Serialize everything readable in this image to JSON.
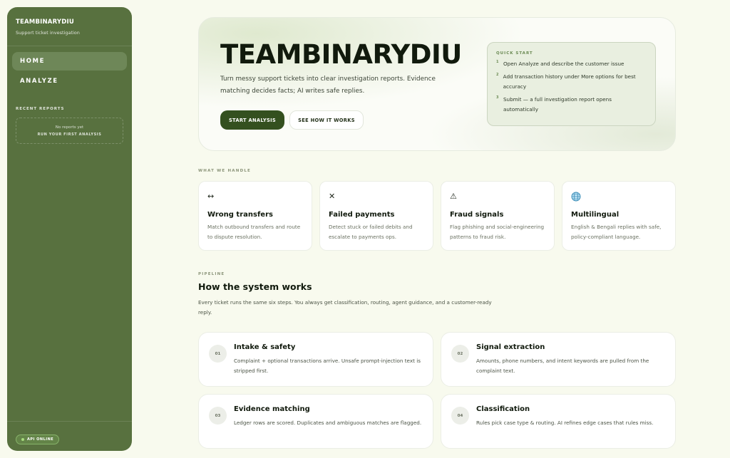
{
  "sidebar": {
    "title": "TEAMBINARYDIU",
    "subtitle": "Support ticket investigation",
    "nav": [
      {
        "label": "HOME",
        "active": true
      },
      {
        "label": "ANALYZE",
        "active": false
      }
    ],
    "recent_reports_title": "RECENT REPORTS",
    "empty_text": "No reports yet",
    "empty_cta": "RUN YOUR FIRST ANALYSIS",
    "api_status": "API ONLINE"
  },
  "hero": {
    "title": "TEAMBINARYDIU",
    "description": "Turn messy support tickets into clear investigation reports. Evidence matching decides facts; AI writes safe replies.",
    "primary_button": "START ANALYSIS",
    "secondary_button": "SEE HOW IT WORKS",
    "quick_start": {
      "title": "QUICK START",
      "items": [
        {
          "num": "1",
          "text": "Open Analyze and describe the customer issue"
        },
        {
          "num": "2",
          "text": "Add transaction history under More options for best accuracy"
        },
        {
          "num": "3",
          "text": "Submit — a full investigation report opens automatically"
        }
      ]
    }
  },
  "handle": {
    "label": "WHAT WE HANDLE",
    "cards": [
      {
        "icon": "arrows-horizontal-icon",
        "glyph": "↔",
        "title": "Wrong transfers",
        "desc": "Match outbound transfers and route to dispute resolution."
      },
      {
        "icon": "x-icon",
        "glyph": "✕",
        "title": "Failed payments",
        "desc": "Detect stuck or failed debits and escalate to payments ops."
      },
      {
        "icon": "warning-icon",
        "glyph": "⚠",
        "title": "Fraud signals",
        "desc": "Flag phishing and social-engineering patterns to fraud risk."
      },
      {
        "icon": "globe-icon",
        "glyph": "",
        "title": "Multilingual",
        "desc": "English & Bengali replies with safe, policy-compliant language."
      }
    ]
  },
  "pipeline": {
    "label": "PIPELINE",
    "title": "How the system works",
    "desc": "Every ticket runs the same six steps. You always get classification, routing, agent guidance, and a customer-ready reply.",
    "steps": [
      {
        "num": "01",
        "title": "Intake & safety",
        "desc": "Complaint + optional transactions arrive. Unsafe prompt-injection text is stripped first."
      },
      {
        "num": "02",
        "title": "Signal extraction",
        "desc": "Amounts, phone numbers, and intent keywords are pulled from the complaint text."
      },
      {
        "num": "03",
        "title": "Evidence matching",
        "desc": "Ledger rows are scored. Duplicates and ambiguous matches are flagged."
      },
      {
        "num": "04",
        "title": "Classification",
        "desc": "Rules pick case type & routing. AI refines edge cases that rules miss."
      }
    ]
  },
  "colors": {
    "sidebar_bg": "#58713f",
    "primary_button_bg": "#34501f",
    "page_bg": "#f8faee"
  }
}
